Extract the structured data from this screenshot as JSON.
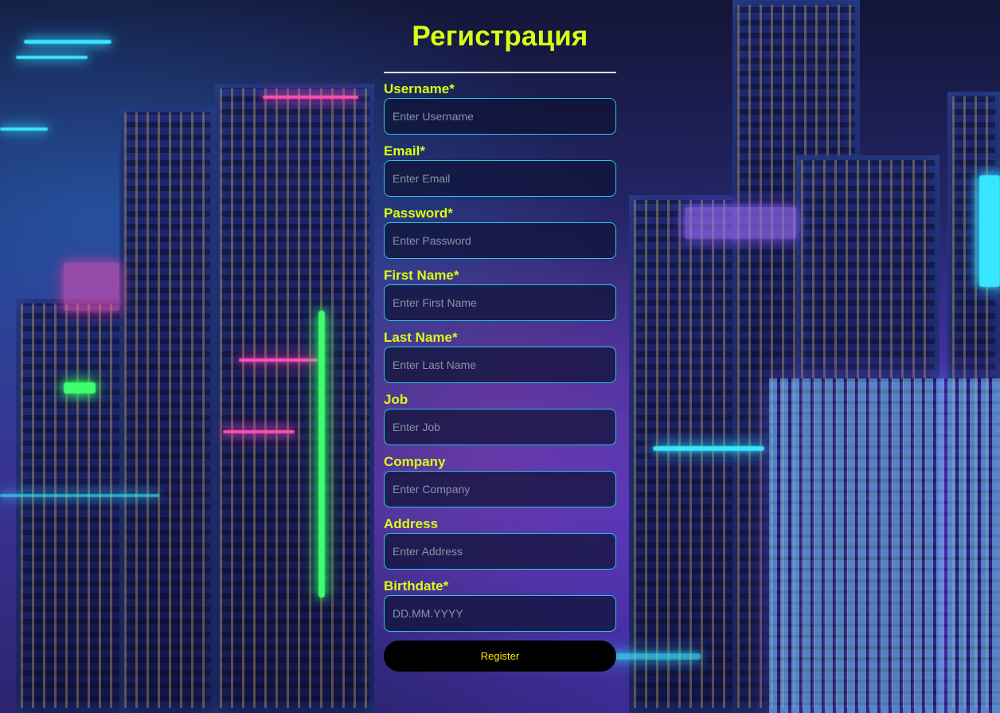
{
  "form": {
    "title": "Регистрация",
    "fields": [
      {
        "label": "Username*",
        "placeholder": "Enter Username"
      },
      {
        "label": "Email*",
        "placeholder": "Enter Email"
      },
      {
        "label": "Password*",
        "placeholder": "Enter Password"
      },
      {
        "label": "First Name*",
        "placeholder": "Enter First Name"
      },
      {
        "label": "Last Name*",
        "placeholder": "Enter Last Name"
      },
      {
        "label": "Job",
        "placeholder": "Enter Job"
      },
      {
        "label": "Company",
        "placeholder": "Enter Company"
      },
      {
        "label": "Address",
        "placeholder": "Enter Address"
      },
      {
        "label": "Birthdate*",
        "placeholder": "DD.MM.YYYY"
      }
    ],
    "register_label": "Register"
  },
  "colors": {
    "accent": "#d8ff14",
    "input_border": "#29c6e8",
    "button_bg": "#000000",
    "button_text": "#ffe600"
  }
}
